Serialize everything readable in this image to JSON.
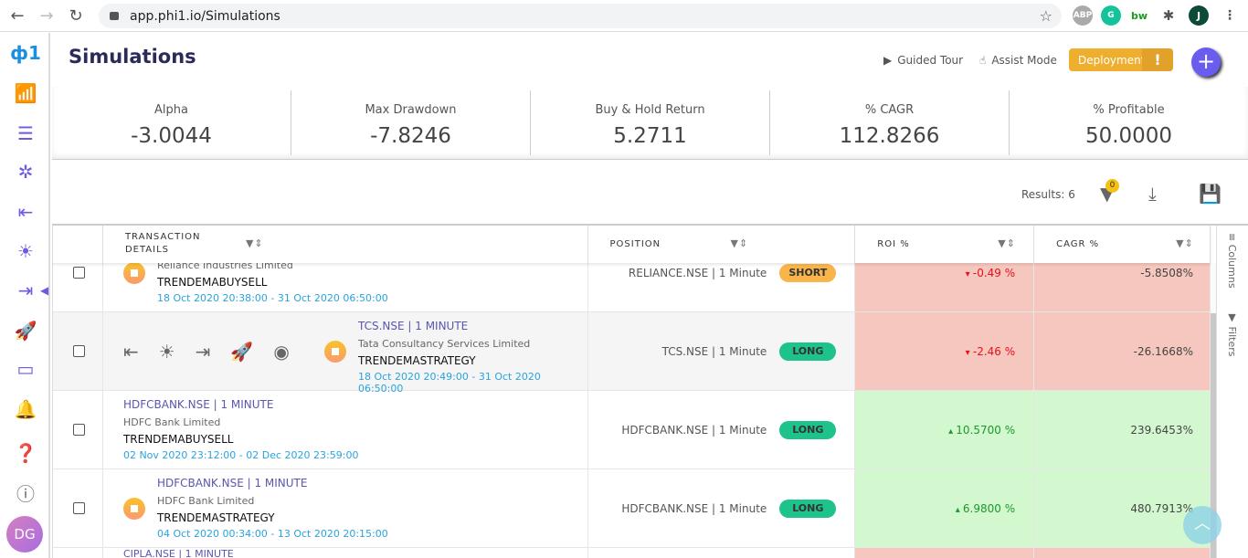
{
  "browser": {
    "url": "app.phi1.io/Simulations",
    "profile": "J",
    "ext": [
      "ABP",
      "G",
      "bw"
    ]
  },
  "sidebar": {
    "icons": [
      "logo-icon",
      "analytics-icon",
      "watchlist-icon",
      "strategy-icon",
      "entry-icon",
      "idea-icon",
      "exit-icon",
      "rocket-icon",
      "monitor-icon",
      "bell-icon",
      "help-icon",
      "info-icon"
    ],
    "avatar": "DG",
    "active_color": "#6a5be0"
  },
  "header": {
    "title": "Simulations",
    "guided_tour": "Guided Tour",
    "assist_mode": "Assist Mode",
    "deployment": "Deployment",
    "deployment_alert": "!"
  },
  "stats": [
    {
      "label": "Alpha",
      "value": "-3.0044"
    },
    {
      "label": "Max Drawdown",
      "value": "-7.8246"
    },
    {
      "label": "Buy & Hold Return",
      "value": "5.2711"
    },
    {
      "label": "% CAGR",
      "value": "112.8266"
    },
    {
      "label": "% Profitable",
      "value": "50.0000"
    }
  ],
  "toolbar": {
    "results": "Results: 6",
    "filter_count": "0"
  },
  "columns": {
    "details_1": "TRANSACTION",
    "details_2": "DETAILS",
    "position": "POSITION",
    "roi": "ROI %",
    "cagr": "CAGR %"
  },
  "side_panel": {
    "columns": "Columns",
    "filters": "Filters"
  },
  "colors": {
    "negative_bg": "#f6c7be",
    "positive_bg": "#d3f8d0",
    "short": "#f9b54a",
    "long": "#1ec28b"
  },
  "rows": [
    {
      "symbol": "",
      "company": "Reliance Industries Limited",
      "strategy": "TRENDEMABUYSELL",
      "dates": "18 Oct 2020 20:38:00 - 31 Oct 2020 06:50:00",
      "position": "RELIANCE.NSE | 1 Minute",
      "side": "SHORT",
      "roi": "-0.49 %",
      "cagr": "-5.8508%",
      "status": true,
      "hover": false
    },
    {
      "symbol": "TCS.NSE | 1 MINUTE",
      "company": "Tata Consultancy Services Limited",
      "strategy": "TRENDEMASTRATEGY",
      "dates": "18 Oct 2020 20:49:00 - 31 Oct 2020 06:50:00",
      "position": "TCS.NSE | 1 Minute",
      "side": "LONG",
      "roi": "-2.46 %",
      "cagr": "-26.1668%",
      "status": true,
      "hover": true
    },
    {
      "symbol": "HDFCBANK.NSE | 1 MINUTE",
      "company": "HDFC Bank Limited",
      "strategy": "TRENDEMABUYSELL",
      "dates": "02 Nov 2020 23:12:00 - 02 Dec 2020 23:59:00",
      "position": "HDFCBANK.NSE | 1 Minute",
      "side": "LONG",
      "roi": "10.5700 %",
      "cagr": "239.6453%",
      "status": false,
      "hover": false
    },
    {
      "symbol": "HDFCBANK.NSE | 1 MINUTE",
      "company": "HDFC Bank Limited",
      "strategy": "TRENDEMASTRATEGY",
      "dates": "04 Oct 2020 00:34:00 - 13 Oct 2020 20:15:00",
      "position": "HDFCBANK.NSE | 1 Minute",
      "side": "LONG",
      "roi": "6.9800 %",
      "cagr": "480.7913%",
      "status": true,
      "hover": false
    },
    {
      "symbol": "CIPLA.NSE | 1 MINUTE",
      "company": "",
      "strategy": "",
      "dates": "",
      "position": "",
      "side": "",
      "roi": "",
      "cagr": "",
      "status": false,
      "hover": false,
      "negative": true
    }
  ]
}
